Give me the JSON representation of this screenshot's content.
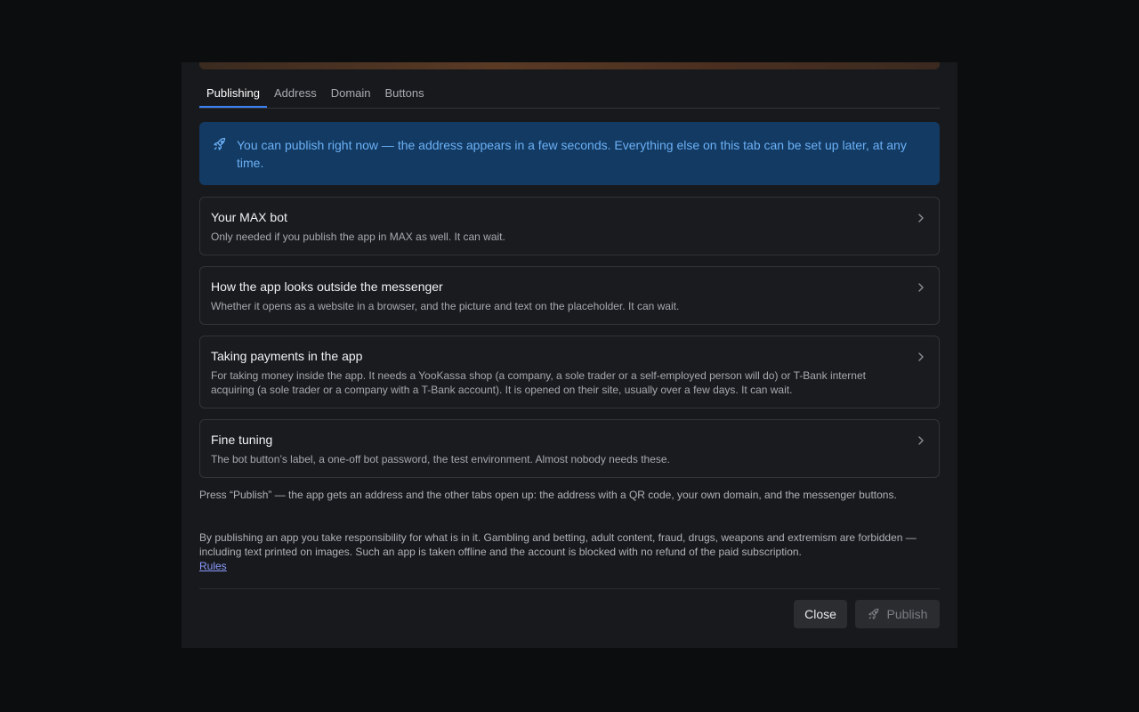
{
  "tabs": [
    {
      "label": "Publishing",
      "active": true
    },
    {
      "label": "Address",
      "active": false
    },
    {
      "label": "Domain",
      "active": false
    },
    {
      "label": "Buttons",
      "active": false
    }
  ],
  "info_banner": {
    "icon": "rocket-icon",
    "text": "You can publish right now — the address appears in a few seconds. Everything else on this tab can be set up later, at any time."
  },
  "cards": [
    {
      "title": "Your MAX bot",
      "description": "Only needed if you publish the app in MAX as well. It can wait."
    },
    {
      "title": "How the app looks outside the messenger",
      "description": "Whether it opens as a website in a browser, and the picture and text on the placeholder. It can wait."
    },
    {
      "title": "Taking payments in the app",
      "description": "For taking money inside the app. It needs a YooKassa shop (a company, a sole trader or a self-employed person will do) or T-Bank internet acquiring (a sole trader or a company with a T-Bank account). It is opened on their site, usually over a few days. It can wait."
    },
    {
      "title": "Fine tuning",
      "description": "The bot button’s label, a one-off bot password, the test environment. Almost nobody needs these."
    }
  ],
  "notes": {
    "publish_hint": "Press “Publish” — the app gets an address and the other tabs open up: the address with a QR code, your own domain, and the messenger buttons.",
    "responsibility": "By publishing an app you take responsibility for what is in it. Gambling and betting, adult content, fraud, drugs, weapons and extremism are forbidden — including text printed on images. Such an app is taken offline and the account is blocked with no refund of the paid subscription.",
    "rules_link": "Rules"
  },
  "footer": {
    "close_label": "Close",
    "publish_label": "Publish",
    "publish_icon": "rocket-icon"
  },
  "colors": {
    "accent": "#3b82f6",
    "banner_bg": "#123a63",
    "banner_text": "#6cb0f5",
    "link": "#8a9cff"
  }
}
